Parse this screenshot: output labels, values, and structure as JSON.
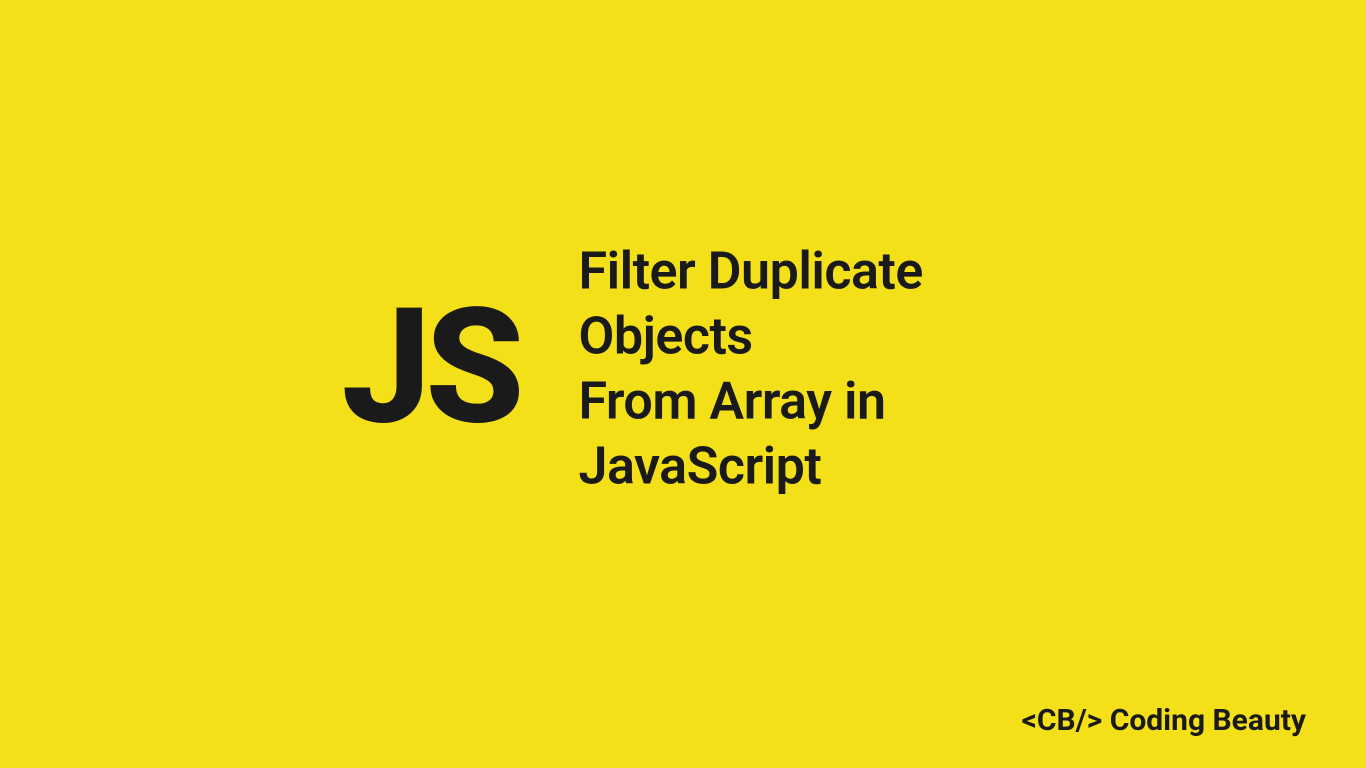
{
  "logo": {
    "text": "JS"
  },
  "title": {
    "line1": "Filter Duplicate Objects",
    "line2": "From Array in JavaScript"
  },
  "brand": {
    "text": "<CB/> Coding Beauty"
  },
  "colors": {
    "background": "#f4e018",
    "text": "#1a1a1a"
  }
}
